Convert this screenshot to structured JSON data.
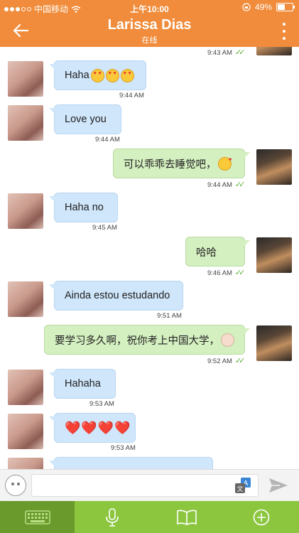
{
  "status_bar": {
    "carrier": "中国移动",
    "time": "上午10:00",
    "battery": "49%",
    "battery_level": 0.49
  },
  "header": {
    "title": "Larissa Dias",
    "subtitle": "在线",
    "back_icon": "back-arrow-icon",
    "menu_icon": "more-vertical-icon"
  },
  "messages": [
    {
      "direction": "out",
      "text": "",
      "time": "9:43 AM",
      "read": true
    },
    {
      "direction": "in",
      "text": "Haha",
      "emoji": [
        "smiling-face-with-heart-eyes",
        "smiling-face-with-heart-eyes",
        "smiling-face-with-heart-eyes"
      ],
      "time": "9:44 AM"
    },
    {
      "direction": "in",
      "text": "Love you",
      "time": "9:44 AM"
    },
    {
      "direction": "out",
      "text": "可以乖乖去睡觉吧，",
      "emoji": [
        "face-blowing-a-kiss"
      ],
      "time": "9:44 AM",
      "read": true
    },
    {
      "direction": "in",
      "text": "Haha no",
      "time": "9:45 AM"
    },
    {
      "direction": "out",
      "text": "哈哈",
      "time": "9:46 AM",
      "read": true
    },
    {
      "direction": "in",
      "text": "Ainda estou estudando",
      "time": "9:51 AM"
    },
    {
      "direction": "out",
      "text": "要学习多久啊，祝你考上中国大学，",
      "emoji": [
        "baby-face"
      ],
      "time": "9:52 AM",
      "read": true
    },
    {
      "direction": "in",
      "text": "Hahaha",
      "time": "9:53 AM"
    },
    {
      "direction": "in",
      "text": "❤️❤️❤️❤️",
      "time": "9:53 AM"
    },
    {
      "direction": "in",
      "text": "",
      "time": ""
    }
  ],
  "input": {
    "placeholder": "",
    "emoji_icon": "emoji-face-icon",
    "translate_icon": "translate-icon",
    "send_icon": "send-icon"
  },
  "toolbar": {
    "items": [
      "keyboard-icon",
      "microphone-icon",
      "book-icon",
      "plus-circle-icon"
    ],
    "active_index": 0
  },
  "colors": {
    "header": "#f08c3b",
    "incoming_bubble": "#cfe6fb",
    "outgoing_bubble": "#d4efc0",
    "toolbar": "#8cc63f",
    "toolbar_active": "#6a9a2c",
    "read_check": "#5bb030"
  }
}
